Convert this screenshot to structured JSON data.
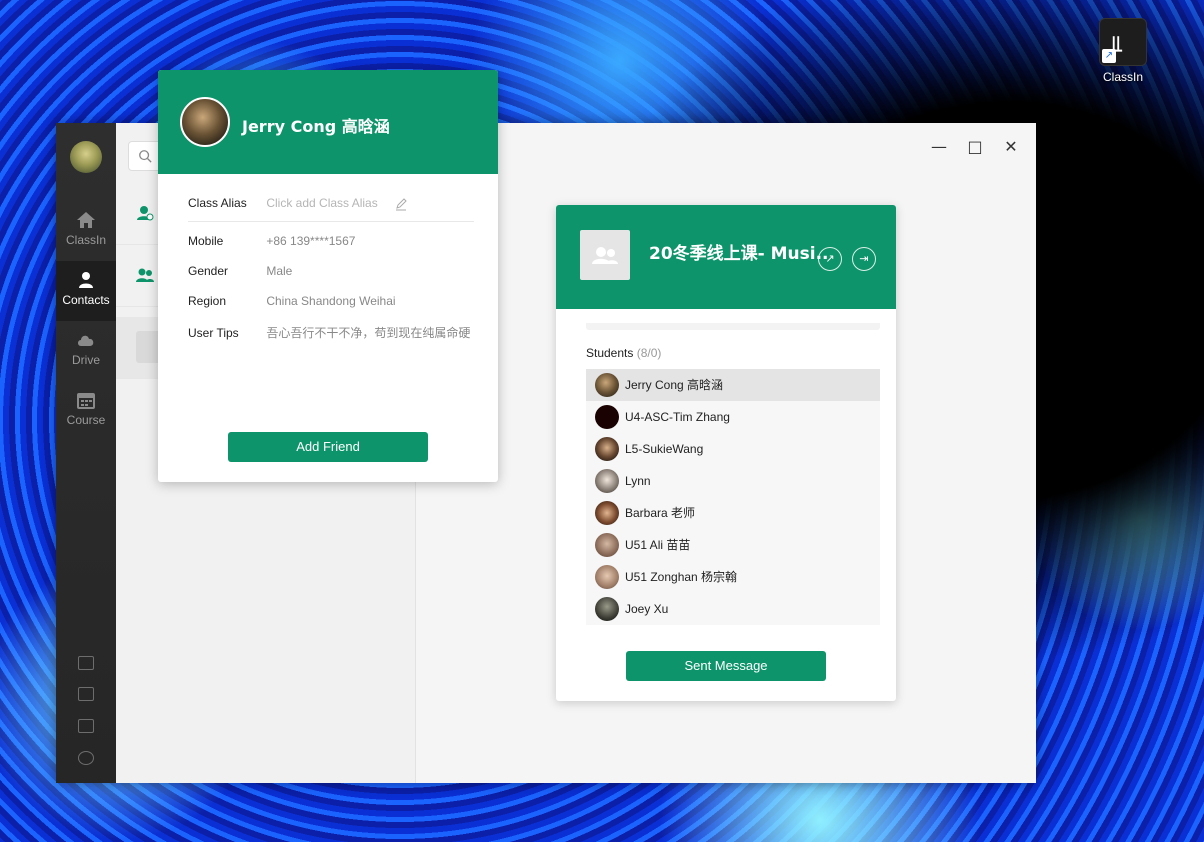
{
  "desktop": {
    "icon_label": "ClassIn",
    "icon_glyph": "⫫"
  },
  "nav": {
    "items": [
      {
        "label": "ClassIn",
        "icon": "home-icon"
      },
      {
        "label": "Contacts",
        "icon": "person-icon"
      },
      {
        "label": "Drive",
        "icon": "cloud-icon"
      },
      {
        "label": "Course",
        "icon": "calendar-icon"
      }
    ],
    "active": "Contacts"
  },
  "window_controls": {
    "minimize": "—",
    "maximize": "□",
    "close": "✕"
  },
  "group": {
    "name": "20冬季线上课- Musi...",
    "students_label": "Students",
    "students_count": "(8/0)",
    "students": [
      {
        "name": "Jerry Cong 高晗涵",
        "selected": true
      },
      {
        "name": "U4-ASC-Tim Zhang"
      },
      {
        "name": "L5-SukieWang"
      },
      {
        "name": "Lynn"
      },
      {
        "name": "Barbara 老师"
      },
      {
        "name": "U51 Ali 苗苗"
      },
      {
        "name": "U51 Zonghan 杨宗翰"
      },
      {
        "name": "Joey Xu"
      }
    ],
    "send_button": "Sent Message"
  },
  "profile": {
    "name": "Jerry Cong 高晗涵",
    "class_alias_label": "Class Alias",
    "class_alias_placeholder": "Click add Class Alias",
    "mobile_label": "Mobile",
    "mobile": "+86 139****1567",
    "gender_label": "Gender",
    "gender": "Male",
    "region_label": "Region",
    "region": "China Shandong Weihai",
    "tips_label": "User Tips",
    "tips": "吾心吾行不干不净，苟到现在纯属命硬",
    "add_friend_button": "Add Friend"
  },
  "colors": {
    "accent": "#0e946a",
    "sidebar": "#2b2b2b"
  }
}
